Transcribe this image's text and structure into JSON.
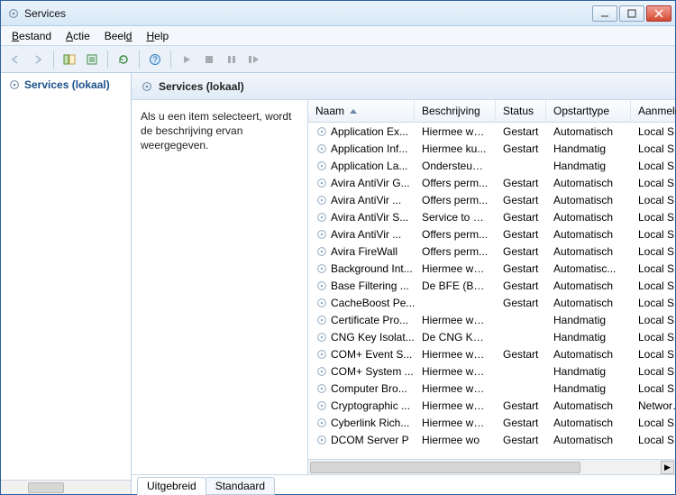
{
  "window": {
    "title": "Services"
  },
  "menus": {
    "bestand": "Bestand",
    "actie": "Actie",
    "beeld": "Beeld",
    "help": "Help"
  },
  "left": {
    "title": "Services (lokaal)"
  },
  "panel": {
    "title": "Services (lokaal)"
  },
  "desc": {
    "text": "Als u een item selecteert, wordt de beschrijving ervan weergegeven."
  },
  "columns": {
    "naam": "Naam",
    "beschrijving": "Beschrijving",
    "status": "Status",
    "opstart": "Opstarttype",
    "aanmeld": "Aanmelde"
  },
  "tabs": {
    "uitgebreid": "Uitgebreid",
    "standaard": "Standaard"
  },
  "services": [
    {
      "naam": "Application Ex...",
      "beschrijving": "Hiermee wo...",
      "status": "Gestart",
      "opstart": "Automatisch",
      "aanmeld": "Local Syst"
    },
    {
      "naam": "Application Inf...",
      "beschrijving": "Hiermee ku...",
      "status": "Gestart",
      "opstart": "Handmatig",
      "aanmeld": "Local Syst"
    },
    {
      "naam": "Application La...",
      "beschrijving": "Ondersteuni...",
      "status": "",
      "opstart": "Handmatig",
      "aanmeld": "Local Serv"
    },
    {
      "naam": "Avira AntiVir G...",
      "beschrijving": "Offers perm...",
      "status": "Gestart",
      "opstart": "Automatisch",
      "aanmeld": "Local Syst"
    },
    {
      "naam": "Avira AntiVir ...",
      "beschrijving": "Offers perm...",
      "status": "Gestart",
      "opstart": "Automatisch",
      "aanmeld": "Local Syst"
    },
    {
      "naam": "Avira AntiVir S...",
      "beschrijving": "Service to sc...",
      "status": "Gestart",
      "opstart": "Automatisch",
      "aanmeld": "Local Syst"
    },
    {
      "naam": "Avira AntiVir ...",
      "beschrijving": "Offers perm...",
      "status": "Gestart",
      "opstart": "Automatisch",
      "aanmeld": "Local Syst"
    },
    {
      "naam": "Avira FireWall",
      "beschrijving": "Offers perm...",
      "status": "Gestart",
      "opstart": "Automatisch",
      "aanmeld": "Local Syst"
    },
    {
      "naam": "Background Int...",
      "beschrijving": "Hiermee wo...",
      "status": "Gestart",
      "opstart": "Automatisc...",
      "aanmeld": "Local Syst"
    },
    {
      "naam": "Base Filtering ...",
      "beschrijving": "De BFE (Bas...",
      "status": "Gestart",
      "opstart": "Automatisch",
      "aanmeld": "Local Serv"
    },
    {
      "naam": "CacheBoost Pe...",
      "beschrijving": "",
      "status": "Gestart",
      "opstart": "Automatisch",
      "aanmeld": "Local Syst"
    },
    {
      "naam": "Certificate Pro...",
      "beschrijving": "Hiermee wo...",
      "status": "",
      "opstart": "Handmatig",
      "aanmeld": "Local Syst"
    },
    {
      "naam": "CNG Key Isolat...",
      "beschrijving": "De CNG Key...",
      "status": "",
      "opstart": "Handmatig",
      "aanmeld": "Local Syst"
    },
    {
      "naam": "COM+ Event S...",
      "beschrijving": "Hiermee wo...",
      "status": "Gestart",
      "opstart": "Automatisch",
      "aanmeld": "Local Serv"
    },
    {
      "naam": "COM+ System ...",
      "beschrijving": "Hiermee wo...",
      "status": "",
      "opstart": "Handmatig",
      "aanmeld": "Local Syst"
    },
    {
      "naam": "Computer Bro...",
      "beschrijving": "Hiermee wo...",
      "status": "",
      "opstart": "Handmatig",
      "aanmeld": "Local Syst"
    },
    {
      "naam": "Cryptographic ...",
      "beschrijving": "Hiermee wo...",
      "status": "Gestart",
      "opstart": "Automatisch",
      "aanmeld": "Network S"
    },
    {
      "naam": "Cyberlink Rich...",
      "beschrijving": "Hiermee wo...",
      "status": "Gestart",
      "opstart": "Automatisch",
      "aanmeld": "Local Syst"
    },
    {
      "naam": "DCOM Server P",
      "beschrijving": "Hiermee wo",
      "status": "Gestart",
      "opstart": "Automatisch",
      "aanmeld": "Local Syst"
    }
  ]
}
